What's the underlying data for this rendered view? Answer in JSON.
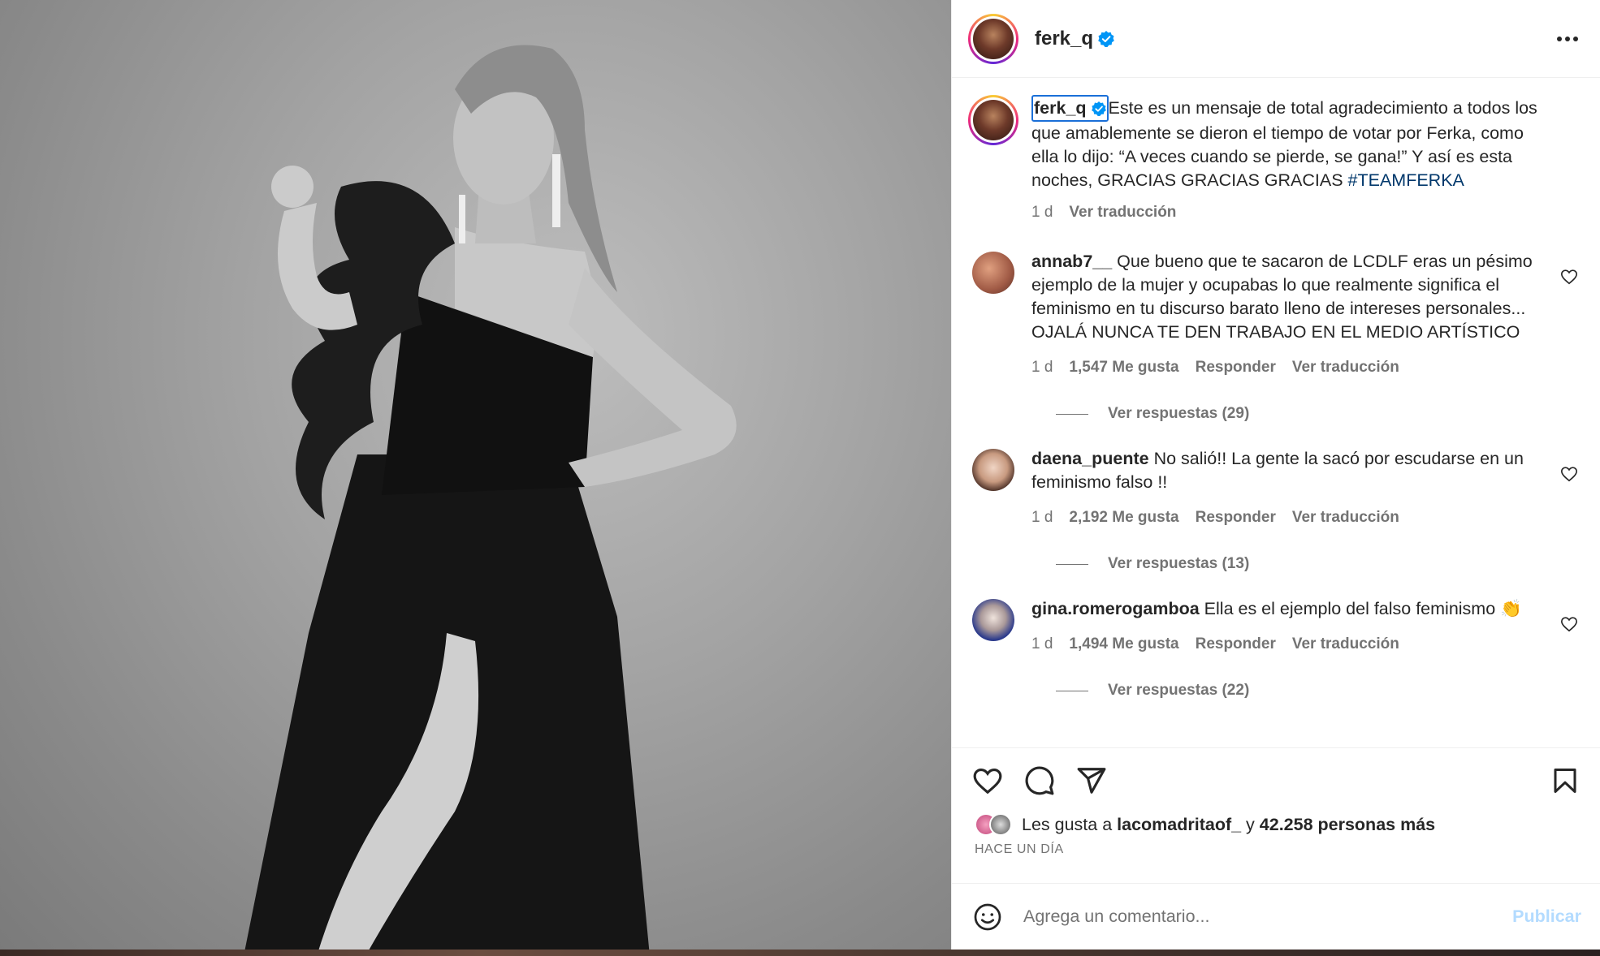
{
  "post": {
    "username": "ferk_q",
    "verified": true,
    "more_icon": "more-horizontal-icon"
  },
  "caption": {
    "username": "ferk_q",
    "text": "Este es un mensaje de total agradecimiento a todos los que amablemente se dieron el tiempo de votar por Ferka, como ella lo dijo: “A veces cuando se pierde, se gana!” Y así es esta noches, GRACIAS GRACIAS GRACIAS ",
    "hashtag": "#TEAMFERKA",
    "time": "1 d",
    "translate": "Ver traducción"
  },
  "comments": [
    {
      "username": "annab7__",
      "text": "Que bueno que te sacaron de LCDLF eras un pésimo ejemplo de la mujer y ocupabas lo que realmente significa el feminismo en tu discurso barato lleno de intereses personales... OJALÁ NUNCA TE DEN TRABAJO EN EL MEDIO ARTÍSTICO",
      "time": "1 d",
      "likes": "1,547 Me gusta",
      "reply": "Responder",
      "translate": "Ver traducción",
      "replies": "Ver respuestas (29)",
      "avatar_color": "#c47a60"
    },
    {
      "username": "daena_puente",
      "text": "No salió!! La gente la sacó por escudarse en un feminismo falso !!",
      "time": "1 d",
      "likes": "2,192 Me gusta",
      "reply": "Responder",
      "translate": "Ver traducción",
      "replies": "Ver respuestas (13)",
      "avatar_color": "#d4b09a"
    },
    {
      "username": "gina.romerogamboa",
      "text": "Ella es el ejemplo del falso feminismo",
      "emoji": "👏",
      "time": "1 d",
      "likes": "1,494 Me gusta",
      "reply": "Responder",
      "translate": "Ver traducción",
      "replies": "Ver respuestas (22)",
      "avatar_color": "#3a3f9e"
    }
  ],
  "actions": {
    "like_icon": "heart-icon",
    "comment_icon": "comment-icon",
    "share_icon": "send-icon",
    "save_icon": "bookmark-icon"
  },
  "likes": {
    "prefix": "Les gusta a ",
    "user": "lacomadritaof_",
    "middle": " y ",
    "others": "42.258 personas más"
  },
  "timestamp": "Hace un día",
  "add_comment": {
    "placeholder": "Agrega un comentario...",
    "publish": "Publicar",
    "emoji_icon": "smiley-icon"
  },
  "colors": {
    "link": "#00376b",
    "verified": "#0095f6",
    "muted": "#737373",
    "publish_disabled": "#b3dbff"
  }
}
